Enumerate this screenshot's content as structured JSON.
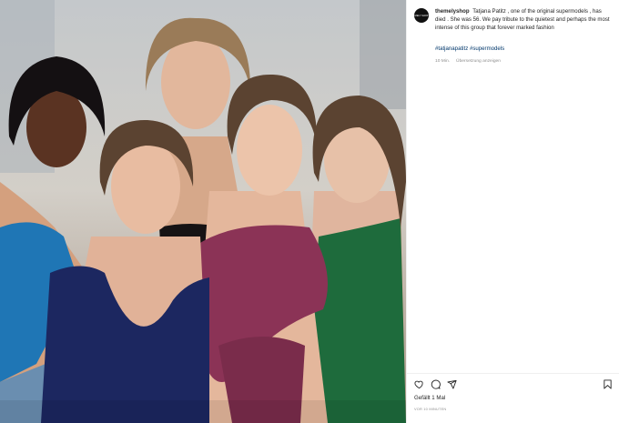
{
  "post": {
    "account": "themelyshop",
    "avatar_text": "MELY SHOP",
    "caption_text": "Tatjana Patitz , one of the original supermodels , has died . She was 56. We pay tribute to the quietest and perhaps the most intense of this group that forever marked fashion",
    "hashtags": "#tatjanapatitz #supermodels",
    "age": "10 Min.",
    "translate_label": "Übersetzung anzeigen",
    "likes_label": "Gefällt 1 Mal",
    "timestamp": "VOR 10 MINUTEN"
  },
  "photo": {
    "subject": "Five supermodels posing together",
    "colors": {
      "left_top": "#1f76b5",
      "left_navy": "#1c2760",
      "center_black": "#161314",
      "center_magenta": "#8b3356",
      "right_green": "#1e6b3c",
      "skin_light": "#e0b59e",
      "skin_dark": "#5a3322",
      "hair_dark": "#141012",
      "hair_brown": "#5b4331",
      "hair_blonde": "#9a7b58"
    }
  },
  "icons": {
    "like": "heart-icon",
    "comment": "comment-icon",
    "share": "share-icon",
    "save": "bookmark-icon"
  }
}
